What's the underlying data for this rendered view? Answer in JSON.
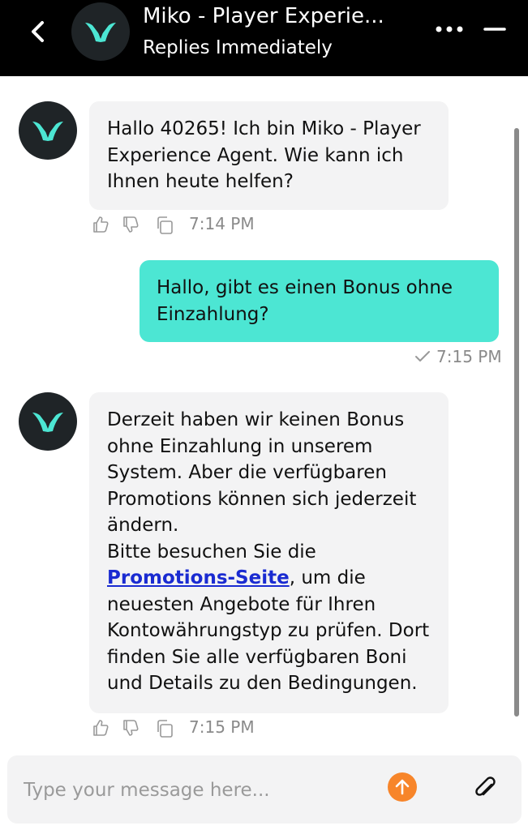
{
  "header": {
    "title": "Miko - Player Experie...",
    "subtitle": "Replies Immediately"
  },
  "messages": [
    {
      "sender": "bot",
      "text": "Hallo 40265! Ich bin Miko - Player Experience Agent. Wie kann ich Ihnen heute helfen?",
      "time": "7:14 PM"
    },
    {
      "sender": "user",
      "text": "Hallo, gibt es einen Bonus ohne Einzahlung?",
      "time": "7:15 PM"
    },
    {
      "sender": "bot",
      "text_part1": "Derzeit haben wir keinen Bonus ohne Einzahlung in unserem System. Aber die verfügbaren Promotions können sich jederzeit ändern.",
      "text_part2": "Bitte besuchen Sie die",
      "link": "Promotions-Seite",
      "text_part3": ", um die neuesten Angebote für Ihren Kontowährungstyp zu prüfen. Dort finden Sie alle verfügbaren Boni und Details zu den Bedingungen.",
      "time": "7:15 PM"
    }
  ],
  "composer": {
    "placeholder": "Type your message here..."
  },
  "colors": {
    "accent": "#4ce6d3",
    "send": "#f7852a",
    "link": "#1a2bd1"
  }
}
